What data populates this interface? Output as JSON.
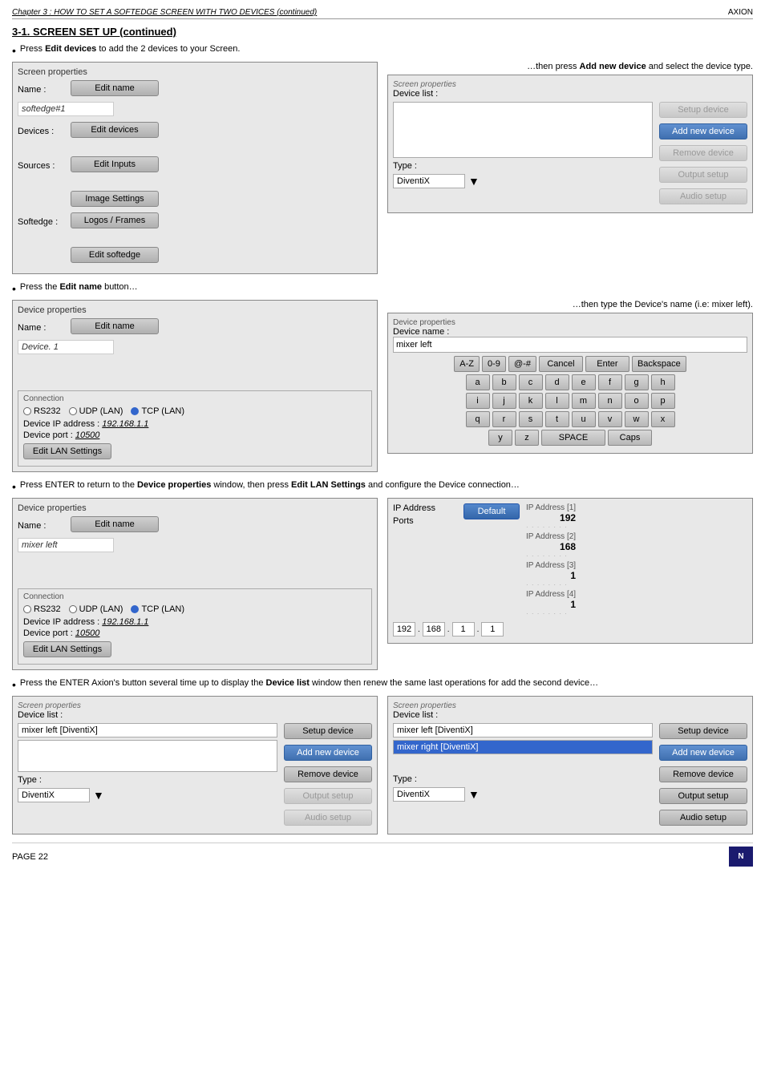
{
  "header": {
    "chapter_link": "Chapter 3 : HOW TO SET A SOFTEDGE SCREEN WITH TWO DEVICES (continued)",
    "brand": "AXION"
  },
  "section": {
    "title": "3-1. SCREEN SET UP (continued)"
  },
  "bullet1": {
    "text_before": "Press ",
    "bold_text": "Edit devices",
    "text_after": " to add the 2 devices to your Screen.",
    "then_text": "…then press ",
    "bold_then": "Add new device",
    "then_after": " and select the device type."
  },
  "screen_props_1": {
    "title": "Screen properties",
    "name_label": "Name :",
    "name_value": "softedge#1",
    "devices_label": "Devices :",
    "devices_value": "",
    "sources_label": "Sources :",
    "sources_value": "",
    "softedge_label": "Softedge :",
    "softedge_value": "",
    "buttons": [
      "Edit name",
      "Edit devices",
      "Edit Inputs",
      "Image Settings",
      "Logos / Frames",
      "Edit softedge"
    ]
  },
  "screen_props_2": {
    "title": "Screen properties",
    "device_list_label": "Device list :",
    "device_list_items": [],
    "type_label": "Type :",
    "type_value": "DiventiX",
    "buttons_right": [
      "Setup device",
      "Add new device",
      "Remove device",
      "Output setup",
      "Audio setup"
    ]
  },
  "bullet2": {
    "text_before": "Press the ",
    "bold_text": "Edit name",
    "text_after": " button…",
    "then_text": "…then type the Device's name (i.e: mixer left)."
  },
  "device_props_1": {
    "title": "Device properties",
    "name_label": "Name :",
    "name_value": "Device. 1",
    "edit_name_btn": "Edit name",
    "connection_title": "Connection",
    "rs232_label": "RS232",
    "udp_label": "UDP (LAN)",
    "tcp_label": "TCP (LAN)",
    "tcp_selected": true,
    "ip_label": "Device IP address :",
    "ip_value": "192.168.1.1",
    "port_label": "Device port",
    "port_value": "10500",
    "edit_lan_btn": "Edit LAN Settings"
  },
  "keyboard_panel": {
    "title": "Device properties",
    "device_name_label": "Device name :",
    "device_name_value": "mixer left",
    "row1": [
      "A-Z",
      "0-9",
      "@-#",
      "Cancel",
      "Enter",
      "Backspace"
    ],
    "row2": [
      "a",
      "b",
      "c",
      "d",
      "e",
      "f",
      "g",
      "h"
    ],
    "row3": [
      "i",
      "j",
      "k",
      "l",
      "m",
      "n",
      "o",
      "p"
    ],
    "row4": [
      "q",
      "r",
      "s",
      "t",
      "u",
      "v",
      "w",
      "x"
    ],
    "row5_left": [
      "y",
      "z"
    ],
    "row5_space": "SPACE",
    "row5_caps": "Caps"
  },
  "bullet3": {
    "text_before": "Press ENTER to return to the ",
    "bold1": "Device properties",
    "text_mid": " window, then press ",
    "bold2": "Edit LAN Settings",
    "text_after": " and configure the Device connection…"
  },
  "device_props_2": {
    "title": "Device properties",
    "name_label": "Name :",
    "name_value": "mixer left",
    "edit_name_btn": "Edit name",
    "connection_title": "Connection",
    "rs232_label": "RS232",
    "udp_label": "UDP (LAN)",
    "tcp_label": "TCP (LAN)",
    "tcp_selected": true,
    "ip_label": "Device IP address :",
    "ip_value": "192.168.1.1",
    "port_label": "Device port",
    "port_value": "10500",
    "edit_lan_btn": "Edit LAN Settings"
  },
  "ip_panel": {
    "ip_address_label": "IP Address",
    "default_btn": "Default",
    "ports_label": "Ports",
    "ip1_label": "IP Address [1]",
    "ip1_value": "192",
    "ip2_label": "IP Address [2]",
    "ip2_value": "168",
    "ip3_label": "IP Address [3]",
    "ip3_value": "1",
    "ip4_label": "IP Address [4]",
    "ip4_value": "1",
    "bottom_row": [
      "192",
      "168",
      "1",
      "1"
    ]
  },
  "bullet4": {
    "text_before": "Press the ENTER Axion's button several time up to display the ",
    "bold_text": "Device list",
    "text_after": " window then renew the same last operations for add the second device…"
  },
  "device_list_left": {
    "title": "Screen properties",
    "device_list_label": "Device list :",
    "items": [
      "mixer left [DiventiX]"
    ],
    "type_label": "Type :",
    "type_value": "DiventiX",
    "buttons": [
      "Setup device",
      "Add new device",
      "Remove device",
      "Output setup",
      "Audio setup"
    ]
  },
  "device_list_right": {
    "title": "Screen properties",
    "device_list_label": "Device list :",
    "items": [
      "mixer left [DiventiX]",
      "mixer right [DiventiX]"
    ],
    "selected_item": "mixer right [DiventiX]",
    "type_label": "Type :",
    "type_value": "DiventiX",
    "buttons": [
      "Setup device",
      "Add new device",
      "Remove device",
      "Output setup",
      "Audio setup"
    ]
  },
  "footer": {
    "page_label": "PAGE 22"
  }
}
